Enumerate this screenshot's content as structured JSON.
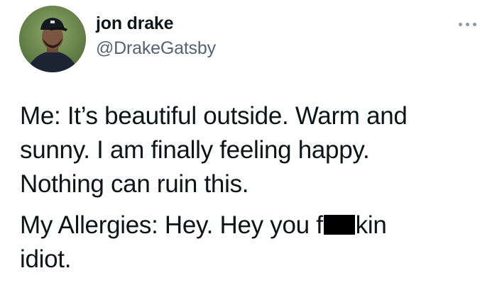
{
  "tweet": {
    "author": {
      "display_name": "jon drake",
      "handle": "@DrakeGatsby",
      "avatar_icon": "profile-photo"
    },
    "more_icon": "ellipsis-icon",
    "paragraphs": [
      {
        "lines": [
          "Me: It’s beautiful outside. Warm and",
          "sunny. I am finally feeling happy.",
          "Nothing can ruin this."
        ]
      }
    ],
    "second_paragraph": {
      "before_censor": "My Allergies: Hey. Hey you f",
      "after_censor": "kin",
      "line2": "idiot."
    }
  },
  "colors": {
    "text": "#0f1419",
    "secondary_text": "#536471",
    "censor_bar": "#000000"
  }
}
